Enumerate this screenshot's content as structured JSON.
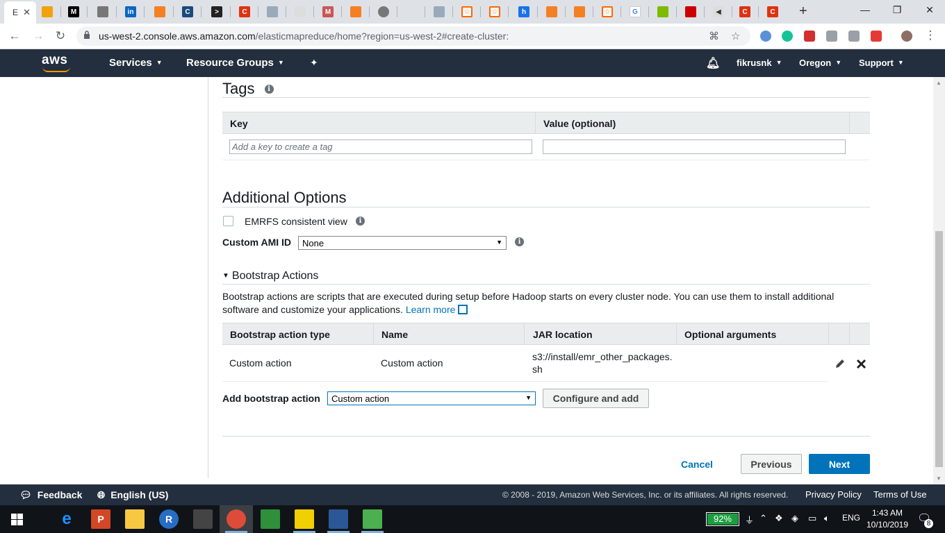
{
  "browser": {
    "active_tab_label": "E",
    "url_host": "us-west-2.console.aws.amazon.com",
    "url_path": "/elasticmapreduce/home?region=us-west-2#create-cluster:"
  },
  "aws_nav": {
    "logo": "aws",
    "services": "Services",
    "resource_groups": "Resource Groups",
    "user": "fikrusnk",
    "region": "Oregon",
    "support": "Support"
  },
  "tags": {
    "heading": "Tags",
    "col_key": "Key",
    "col_value": "Value (optional)",
    "key_placeholder": "Add a key to create a tag",
    "value_placeholder": ""
  },
  "additional_options": {
    "heading": "Additional Options",
    "emrfs_label": "EMRFS consistent view",
    "ami_label": "Custom AMI ID",
    "ami_value": "None"
  },
  "bootstrap": {
    "heading": "Bootstrap Actions",
    "desc": "Bootstrap actions are scripts that are executed during setup before Hadoop starts on every cluster node. You can use them to install additional software and customize your applications.",
    "learn_more": "Learn more",
    "columns": [
      "Bootstrap action type",
      "Name",
      "JAR location",
      "Optional arguments"
    ],
    "rows": [
      {
        "type": "Custom action",
        "name": "Custom action",
        "jar_line1": "s3://install/emr_other_packages.",
        "jar_line2": "sh",
        "args": ""
      }
    ],
    "add_label": "Add bootstrap action",
    "add_value": "Custom action",
    "configure_button": "Configure and add"
  },
  "wizard": {
    "cancel": "Cancel",
    "previous": "Previous",
    "next": "Next"
  },
  "footer": {
    "feedback": "Feedback",
    "language": "English (US)",
    "copyright": "© 2008 - 2019, Amazon Web Services, Inc. or its affiliates. All rights reserved.",
    "privacy": "Privacy Policy",
    "terms": "Terms of Use"
  },
  "taskbar": {
    "battery": "92%",
    "lang": "ENG",
    "time": "1:43 AM",
    "date": "10/10/2019",
    "notifications": "8"
  },
  "colors": {
    "aws_nav": "#232f3e",
    "primary": "#0073bb",
    "orange": "#ff9900"
  }
}
